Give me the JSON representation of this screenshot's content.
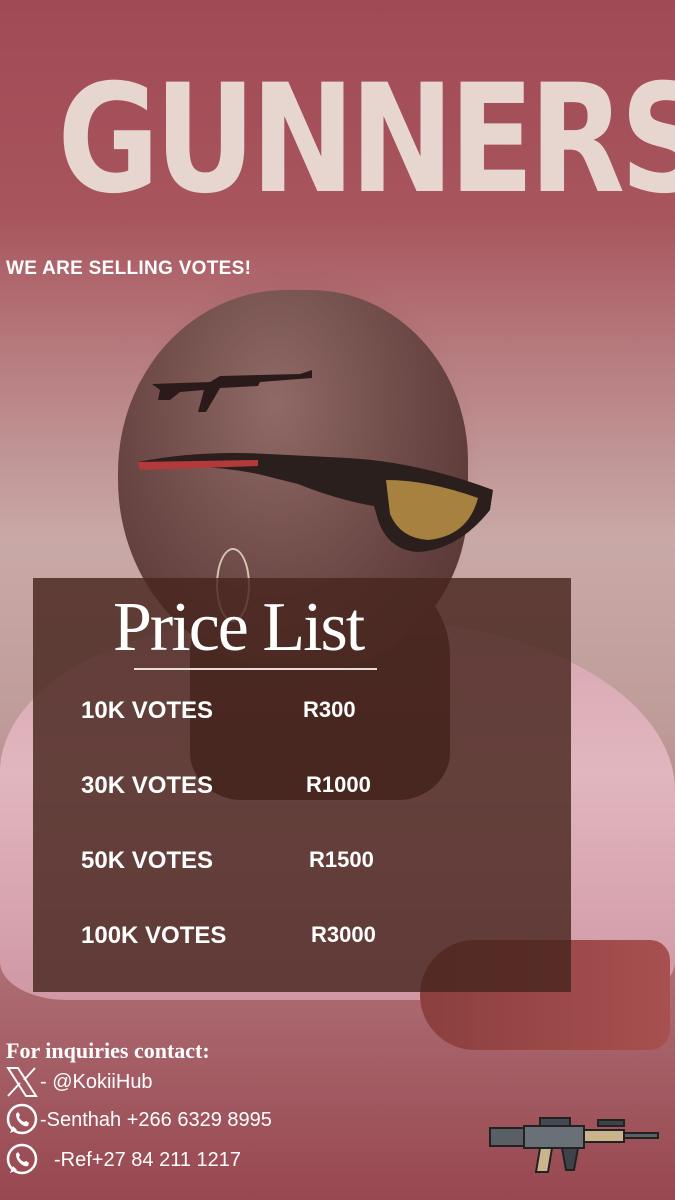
{
  "poster": {
    "title": "GUNNERS",
    "tagline": "WE ARE SELLING VOTES!"
  },
  "price_list": {
    "heading": "Price List",
    "rows": [
      {
        "votes": "10K VOTES",
        "price": "R300"
      },
      {
        "votes": "30K VOTES",
        "price": "R1000"
      },
      {
        "votes": "50K VOTES",
        "price": "R1500"
      },
      {
        "votes": "100K VOTES",
        "price": "R3000"
      }
    ]
  },
  "contacts": {
    "heading": "For inquiries contact:",
    "x_handle": "- @KokiiHub",
    "whatsapp_1": "-Senthah +266 6329 8995",
    "whatsapp_2": "-Ref+27 84 211 1217"
  },
  "colors": {
    "title": "#e7d5cf",
    "panel": "#48261e",
    "text": "#ffffff"
  },
  "icons": [
    "x-logo-icon",
    "whatsapp-icon",
    "rifle-icon"
  ]
}
